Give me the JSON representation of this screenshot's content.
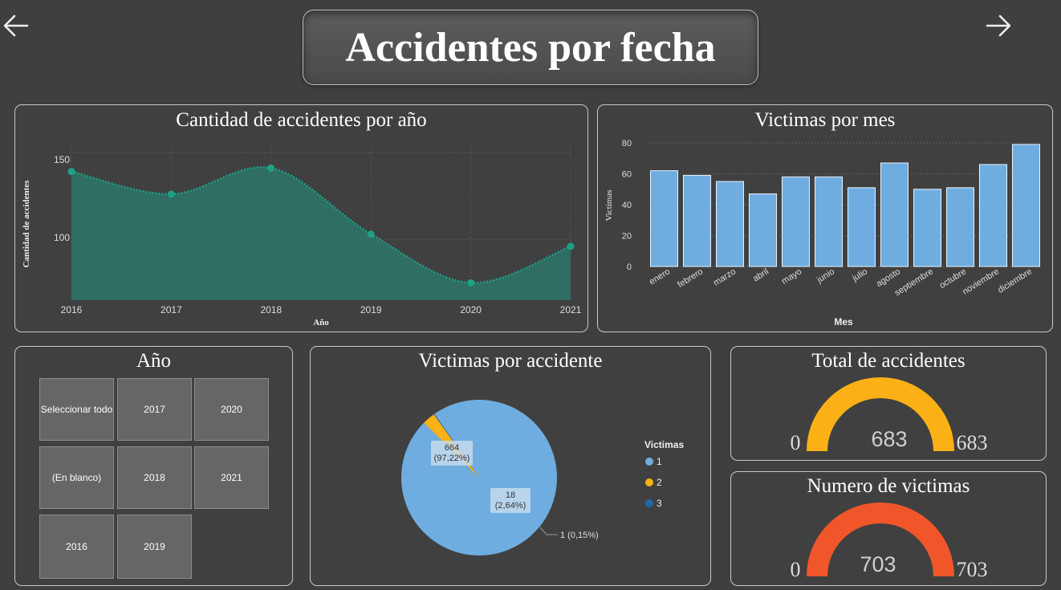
{
  "header": {
    "title": "Accidentes por fecha"
  },
  "nav": {
    "back_icon": "arrow-left-icon",
    "forward_icon": "arrow-right-icon"
  },
  "cards": {
    "accidents_by_year": {
      "title": "Cantidad de accidentes por año",
      "chart_data": {
        "type": "area",
        "x": [
          "2016",
          "2017",
          "2018",
          "2019",
          "2020",
          "2021"
        ],
        "values": [
          139,
          126,
          141,
          103,
          75,
          96
        ],
        "xlabel": "Año",
        "ylabel": "Cantidad de accidentes",
        "yticks": [
          "150",
          "100"
        ],
        "color": "#1fa085"
      }
    },
    "victims_by_month": {
      "title": "Victimas por mes",
      "chart_data": {
        "type": "bar",
        "categories": [
          "enero",
          "febrero",
          "marzo",
          "abril",
          "mayo",
          "junio",
          "julio",
          "agosto",
          "septiembre",
          "octubre",
          "noviembre",
          "diciembre"
        ],
        "values": [
          62,
          59,
          55,
          47,
          58,
          58,
          51,
          67,
          50,
          51,
          66,
          79
        ],
        "xlabel": "Mes",
        "ylabel": "Victimas",
        "ylim": [
          0,
          80
        ],
        "yticks": [
          "0",
          "20",
          "40",
          "60",
          "80"
        ],
        "color": "#6fade0"
      }
    },
    "year_slicer": {
      "title": "Año",
      "buttons": [
        "Seleccionar todo",
        "2017",
        "2020",
        "(En blanco)",
        "2018",
        "2021",
        "2016",
        "2019"
      ]
    },
    "victims_per_accident": {
      "title": "Victimas por accidente",
      "chart_data": {
        "type": "pie",
        "legend_title": "Victimas",
        "labels": [
          "1",
          "2",
          "3"
        ],
        "values": [
          664,
          18,
          1
        ],
        "data_labels": [
          {
            "value": "664",
            "pct": "(97,22%)"
          },
          {
            "value": "18",
            "pct": "(2,64%)"
          },
          {
            "value": "1 (0,15%)"
          }
        ],
        "colors": [
          "#6fade0",
          "#fbb116",
          "#1f6aa8"
        ]
      }
    },
    "total_accidents": {
      "title": "Total de accidentes",
      "gauge": {
        "value": 683,
        "min": "0",
        "max": "683",
        "value_label": "683",
        "color": "#fbb116"
      }
    },
    "victims_count": {
      "title": "Numero de victimas",
      "gauge": {
        "value": 703,
        "min": "0",
        "max": "703",
        "value_label": "703",
        "color": "#f0562a"
      }
    }
  }
}
